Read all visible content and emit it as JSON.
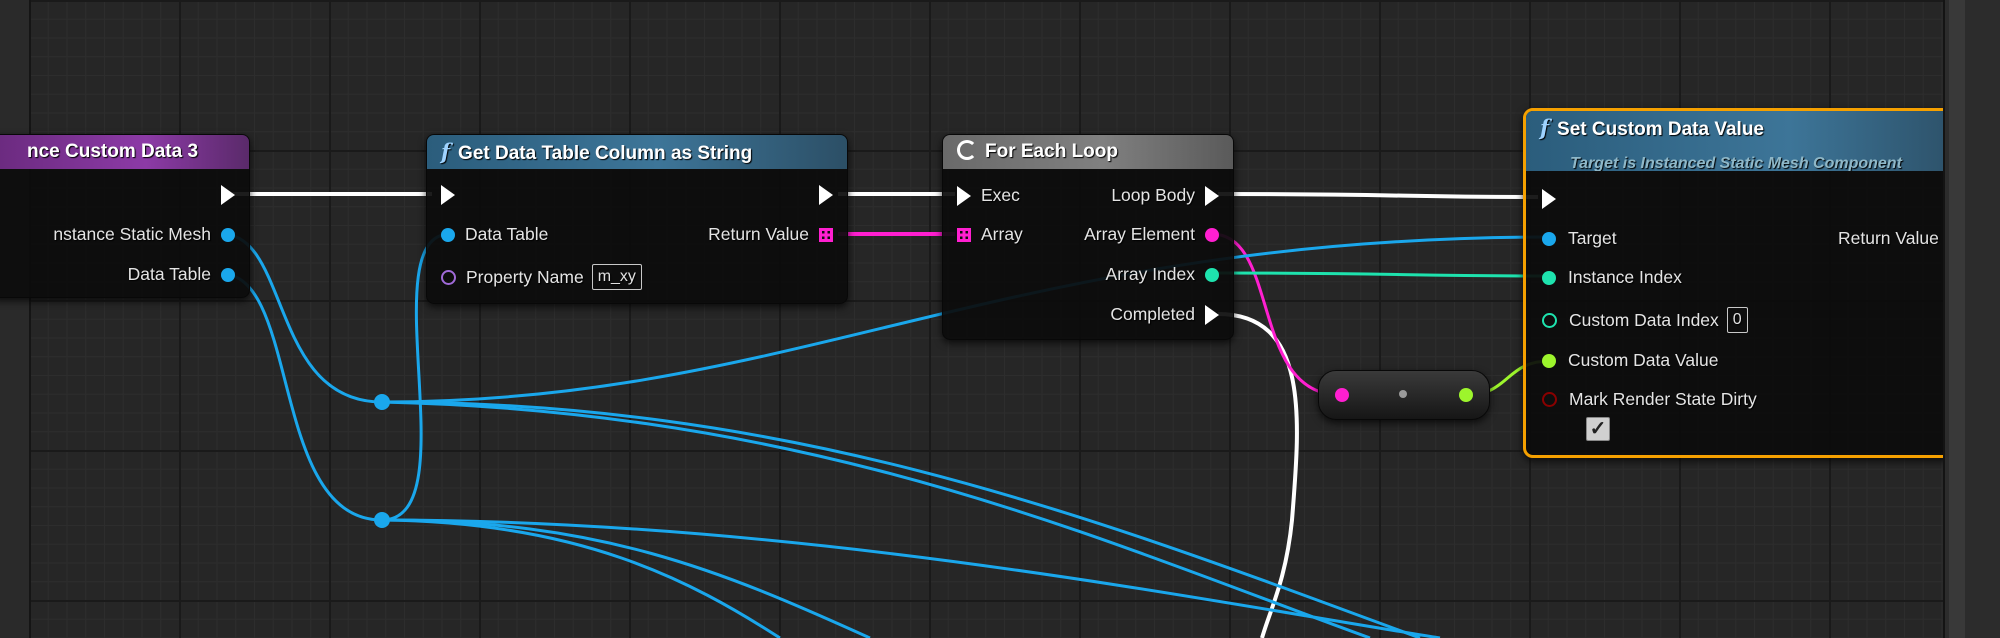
{
  "nodes": {
    "custom_data_3": {
      "title": "nce Custom Data 3",
      "pins": {
        "instance_static_mesh": "nstance Static Mesh",
        "data_table": "Data Table"
      }
    },
    "get_data_table_column": {
      "title": "Get Data Table Column as String",
      "pins": {
        "data_table": "Data Table",
        "property_name": "Property Name",
        "property_name_value": "m_xy",
        "return_value": "Return Value"
      }
    },
    "for_each_loop": {
      "title": "For Each Loop",
      "pins": {
        "exec": "Exec",
        "array": "Array",
        "loop_body": "Loop Body",
        "array_element": "Array Element",
        "array_index": "Array Index",
        "completed": "Completed"
      }
    },
    "set_custom_data_value": {
      "title": "Set Custom Data Value",
      "subtitle": "Target is Instanced Static Mesh Component",
      "pins": {
        "target": "Target",
        "return_value": "Return Value",
        "instance_index": "Instance Index",
        "custom_data_index": "Custom Data Index",
        "custom_data_index_value": "0",
        "custom_data_value": "Custom Data Value",
        "mark_render_state_dirty": "Mark Render State Dirty",
        "mark_render_state_dirty_checked": true
      }
    }
  },
  "colors": {
    "exec": "#ffffff",
    "object": "#1aa7ec",
    "array": "#ff1fd0",
    "integer": "#1ee3ae",
    "float": "#9df52c",
    "struct_outline": "#a06ad8",
    "bool": "#8a0000",
    "selection": "#f5a000"
  }
}
